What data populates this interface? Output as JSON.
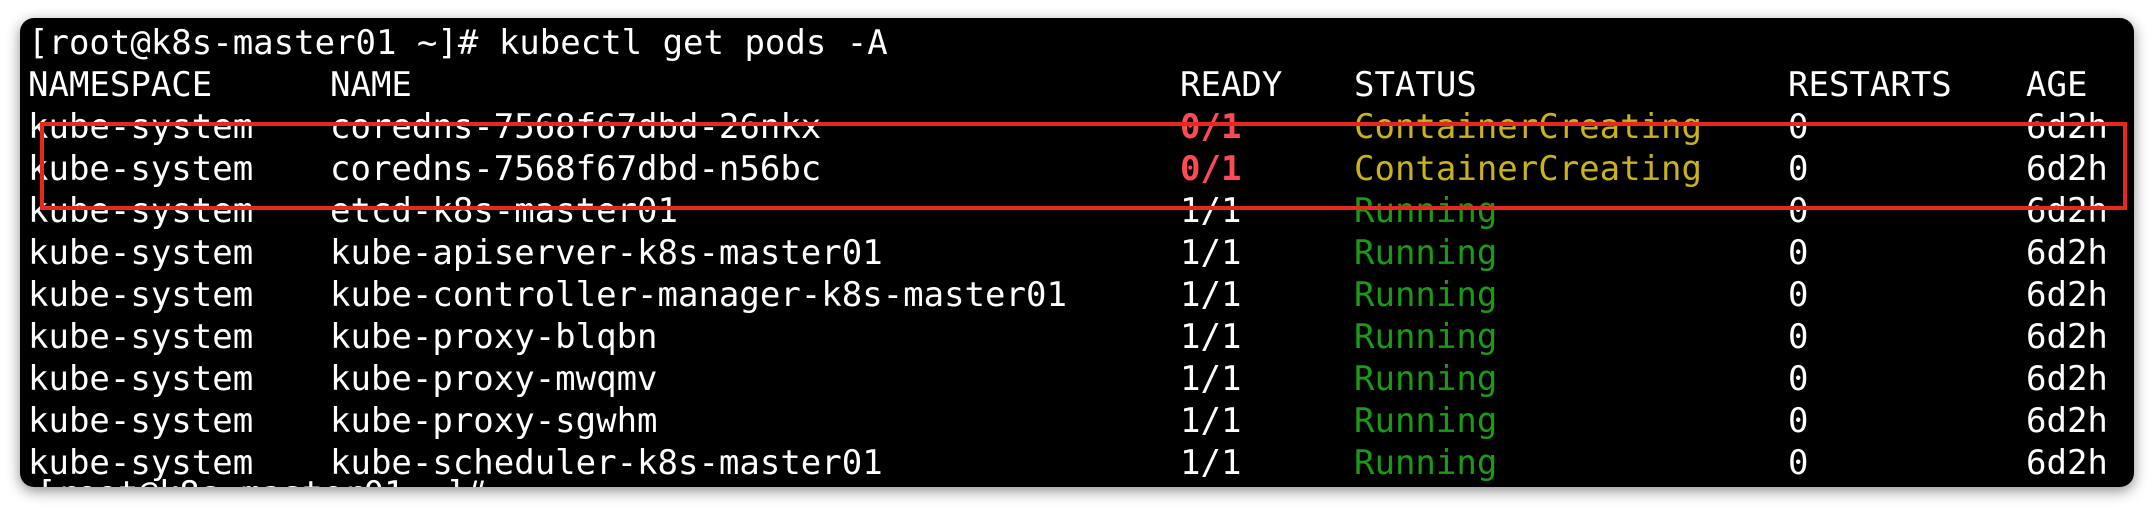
{
  "terminal": {
    "prompt": "[root@k8s-master01 ~]# ",
    "command": "kubectl get pods -A"
  },
  "table": {
    "headers": {
      "namespace": "NAMESPACE",
      "name": "NAME",
      "ready": "READY",
      "status": "STATUS",
      "restarts": "RESTARTS",
      "age": "AGE"
    },
    "rows": [
      {
        "namespace": "kube-system",
        "name": "coredns-7568f67dbd-26nkx",
        "ready": "0/1",
        "status": "ContainerCreating",
        "restarts": "0",
        "age": "6d2h"
      },
      {
        "namespace": "kube-system",
        "name": "coredns-7568f67dbd-n56bc",
        "ready": "0/1",
        "status": "ContainerCreating",
        "restarts": "0",
        "age": "6d2h"
      },
      {
        "namespace": "kube-system",
        "name": "etcd-k8s-master01",
        "ready": "1/1",
        "status": "Running",
        "restarts": "0",
        "age": "6d2h"
      },
      {
        "namespace": "kube-system",
        "name": "kube-apiserver-k8s-master01",
        "ready": "1/1",
        "status": "Running",
        "restarts": "0",
        "age": "6d2h"
      },
      {
        "namespace": "kube-system",
        "name": "kube-controller-manager-k8s-master01",
        "ready": "1/1",
        "status": "Running",
        "restarts": "0",
        "age": "6d2h"
      },
      {
        "namespace": "kube-system",
        "name": "kube-proxy-blqbn",
        "ready": "1/1",
        "status": "Running",
        "restarts": "0",
        "age": "6d2h"
      },
      {
        "namespace": "kube-system",
        "name": "kube-proxy-mwqmv",
        "ready": "1/1",
        "status": "Running",
        "restarts": "0",
        "age": "6d2h"
      },
      {
        "namespace": "kube-system",
        "name": "kube-proxy-sgwhm",
        "ready": "1/1",
        "status": "Running",
        "restarts": "0",
        "age": "6d2h"
      },
      {
        "namespace": "kube-system",
        "name": "kube-scheduler-k8s-master01",
        "ready": "1/1",
        "status": "Running",
        "restarts": "0",
        "age": "6d2h"
      }
    ]
  },
  "colors": {
    "background": "#000000",
    "text": "#ffffff",
    "not_ready": "#ff4a55",
    "container_creating": "#c9b21a",
    "running": "#1b9a15",
    "highlight_box": "#e8281e"
  }
}
